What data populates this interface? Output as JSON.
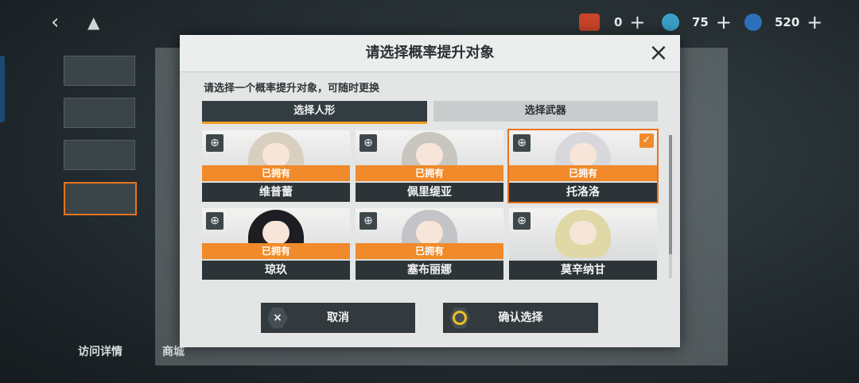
{
  "topbar": {
    "back_icon": "chevron-left-icon",
    "resources": [
      {
        "name": "ticket",
        "value": "0",
        "color": "#c9452a"
      },
      {
        "name": "core",
        "value": "75",
        "color": "#3aa0c8"
      },
      {
        "name": "coin",
        "value": "520",
        "color": "#2d6fb8"
      }
    ],
    "plus_label": "+"
  },
  "background": {
    "visit_details": "访问详情",
    "shop": "商城"
  },
  "modal": {
    "title": "请选择概率提升对象",
    "close_icon": "×",
    "subtitle": "请选择一个概率提升对象，可随时更换",
    "tabs": [
      {
        "label": "选择人形",
        "active": true
      },
      {
        "label": "选择武器",
        "active": false
      }
    ],
    "zoom_icon": "⊕",
    "check_icon": "✓",
    "characters": [
      {
        "name": "维普蕾",
        "owned": "已拥有",
        "hair": "#d9cfc0"
      },
      {
        "name": "佩里缇亚",
        "owned": "已拥有",
        "hair": "#c9c6bf"
      },
      {
        "name": "托洛洛",
        "owned": "已拥有",
        "hair": "#d8d8dc",
        "selected": true
      },
      {
        "name": "琼玖",
        "owned": "已拥有",
        "hair": "#1d1d22"
      },
      {
        "name": "塞布丽娜",
        "owned": "已拥有",
        "hair": "#c3c3c8"
      },
      {
        "name": "莫辛纳甘",
        "owned": "",
        "hair": "#e0d8a6"
      }
    ],
    "cancel_label": "取消",
    "cancel_icon": "×",
    "confirm_label": "确认选择"
  }
}
